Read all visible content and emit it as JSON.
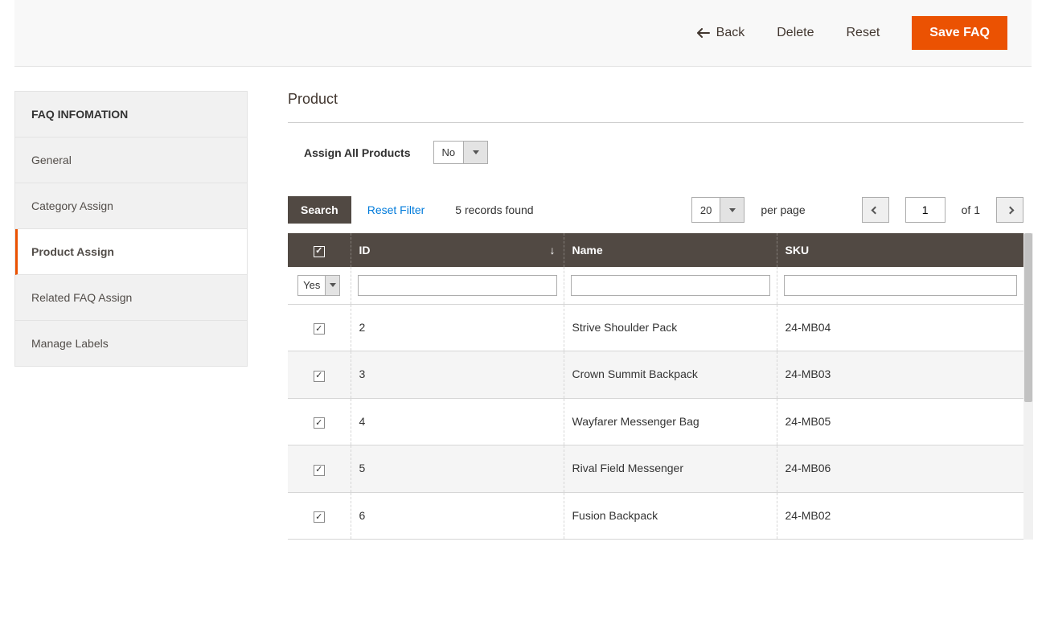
{
  "header": {
    "back": "Back",
    "delete": "Delete",
    "reset": "Reset",
    "save": "Save FAQ"
  },
  "sidebar": {
    "title": "FAQ INFOMATION",
    "items": [
      {
        "label": "General"
      },
      {
        "label": "Category Assign"
      },
      {
        "label": "Product Assign"
      },
      {
        "label": "Related FAQ Assign"
      },
      {
        "label": "Manage Labels"
      }
    ],
    "active_index": 2
  },
  "section": {
    "title": "Product",
    "assign_all_label": "Assign All Products",
    "assign_all_value": "No"
  },
  "toolbar": {
    "search": "Search",
    "reset_filter": "Reset Filter",
    "records_found": "5 records found",
    "per_page_value": "20",
    "per_page_label": "per page",
    "page_value": "1",
    "of_label": "of 1"
  },
  "grid": {
    "columns": {
      "id": "ID",
      "name": "Name",
      "sku": "SKU"
    },
    "filter_yes": "Yes",
    "rows": [
      {
        "checked": true,
        "id": "2",
        "name": "Strive Shoulder Pack",
        "sku": "24-MB04"
      },
      {
        "checked": true,
        "id": "3",
        "name": "Crown Summit Backpack",
        "sku": "24-MB03"
      },
      {
        "checked": true,
        "id": "4",
        "name": "Wayfarer Messenger Bag",
        "sku": "24-MB05"
      },
      {
        "checked": true,
        "id": "5",
        "name": "Rival Field Messenger",
        "sku": "24-MB06"
      },
      {
        "checked": true,
        "id": "6",
        "name": "Fusion Backpack",
        "sku": "24-MB02"
      }
    ]
  }
}
